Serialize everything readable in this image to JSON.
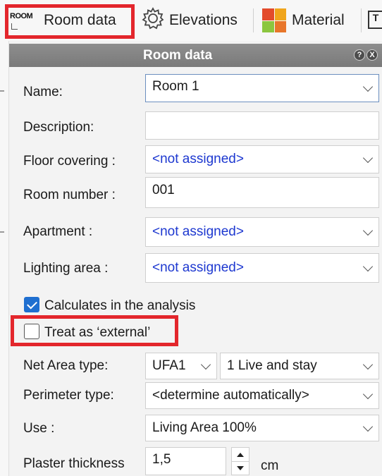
{
  "toolbar": {
    "room_icon_text": "ROOM",
    "room_data_label": "Room data",
    "elevations_label": "Elevations",
    "material_label": "Material",
    "extra_glyph": "T"
  },
  "panel": {
    "title": "Room data",
    "help_glyph": "?",
    "close_glyph": "X"
  },
  "form": {
    "name": {
      "label": "Name:",
      "value": "Room 1"
    },
    "description": {
      "label": "Description:",
      "value": ""
    },
    "floor_covering": {
      "label": "Floor covering :",
      "value": "<not assigned>"
    },
    "room_number": {
      "label": "Room number :",
      "value": "001"
    },
    "apartment": {
      "label": "Apartment :",
      "value": "<not assigned>"
    },
    "lighting_area": {
      "label": "Lighting area :",
      "value": "<not assigned>"
    },
    "calculates": {
      "label": "Calculates in the analysis",
      "checked": true
    },
    "treat_external": {
      "label": "Treat as ‘external’",
      "checked": false
    },
    "net_area_type": {
      "label": "Net Area type:",
      "code": "UFA1",
      "value": "1 Live and stay"
    },
    "perimeter_type": {
      "label": "Perimeter type:",
      "value": "<determine automatically>"
    },
    "use": {
      "label": "Use :",
      "value": "Living Area 100%"
    },
    "plaster_thickness": {
      "label": "Plaster thickness",
      "value": "1,5",
      "unit": "cm"
    }
  },
  "colors": {
    "highlight": "#e3262c",
    "link_blue": "#1d38d0",
    "checkbox_blue": "#1f6fd0",
    "header_gray": "#808080",
    "material_icon": [
      "#e34b2b",
      "#f0a51c",
      "#8cc63f",
      "#e8762a"
    ]
  },
  "icons": [
    "room-icon",
    "gear-icon",
    "material-icon",
    "help-icon",
    "close-icon",
    "chevron-down-icon"
  ]
}
